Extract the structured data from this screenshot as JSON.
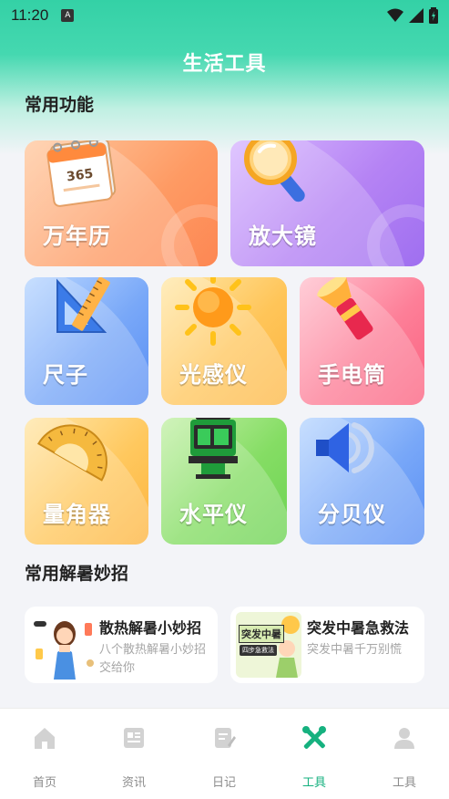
{
  "status_bar": {
    "time": "11:20",
    "notification_badge": "A"
  },
  "page_title": "生活工具",
  "sections": {
    "common_functions": "常用功能",
    "heat_tips": "常用解暑妙招"
  },
  "tools": [
    {
      "id": "calendar",
      "label": "万年历",
      "icon": "calendar-icon",
      "calendar_number": "365"
    },
    {
      "id": "magnifier",
      "label": "放大镜",
      "icon": "magnifier-icon"
    },
    {
      "id": "ruler",
      "label": "尺子",
      "icon": "ruler-icon"
    },
    {
      "id": "light-sensor",
      "label": "光感仪",
      "icon": "sun-icon"
    },
    {
      "id": "flashlight",
      "label": "手电筒",
      "icon": "flashlight-icon"
    },
    {
      "id": "protractor",
      "label": "量角器",
      "icon": "protractor-icon"
    },
    {
      "id": "level",
      "label": "水平仪",
      "icon": "laser-level-icon"
    },
    {
      "id": "decibel",
      "label": "分贝仪",
      "icon": "speaker-icon"
    }
  ],
  "tips": [
    {
      "title": "散热解暑小妙招",
      "desc": "八个散热解暑小妙招交给你",
      "thumb": "girl-cooling-illustration"
    },
    {
      "title": "突发中暑急救法",
      "desc": "突发中暑千万别慌",
      "thumb": "heatstroke-illustration",
      "thumb_text": "突发中暑",
      "thumb_sub": "四步急救法"
    }
  ],
  "bottom_nav": [
    {
      "label": "首页",
      "icon": "home-icon",
      "active": false
    },
    {
      "label": "资讯",
      "icon": "news-icon",
      "active": false
    },
    {
      "label": "日记",
      "icon": "diary-icon",
      "active": false
    },
    {
      "label": "工具",
      "icon": "tools-icon",
      "active": true
    },
    {
      "label": "工具",
      "icon": "profile-icon",
      "active": false
    }
  ],
  "colors": {
    "accent": "#16b17f",
    "header_green": "#34d1a6",
    "calendar_card": "#fe8f5b",
    "magnifier_card": "#a877f0",
    "ruler_card": "#5a92f4",
    "sensor_card": "#fdb540",
    "flashlight_card": "#fb6280",
    "protractor_card": "#fdb540",
    "level_card": "#6dd354",
    "decibel_card": "#5a92f4"
  }
}
